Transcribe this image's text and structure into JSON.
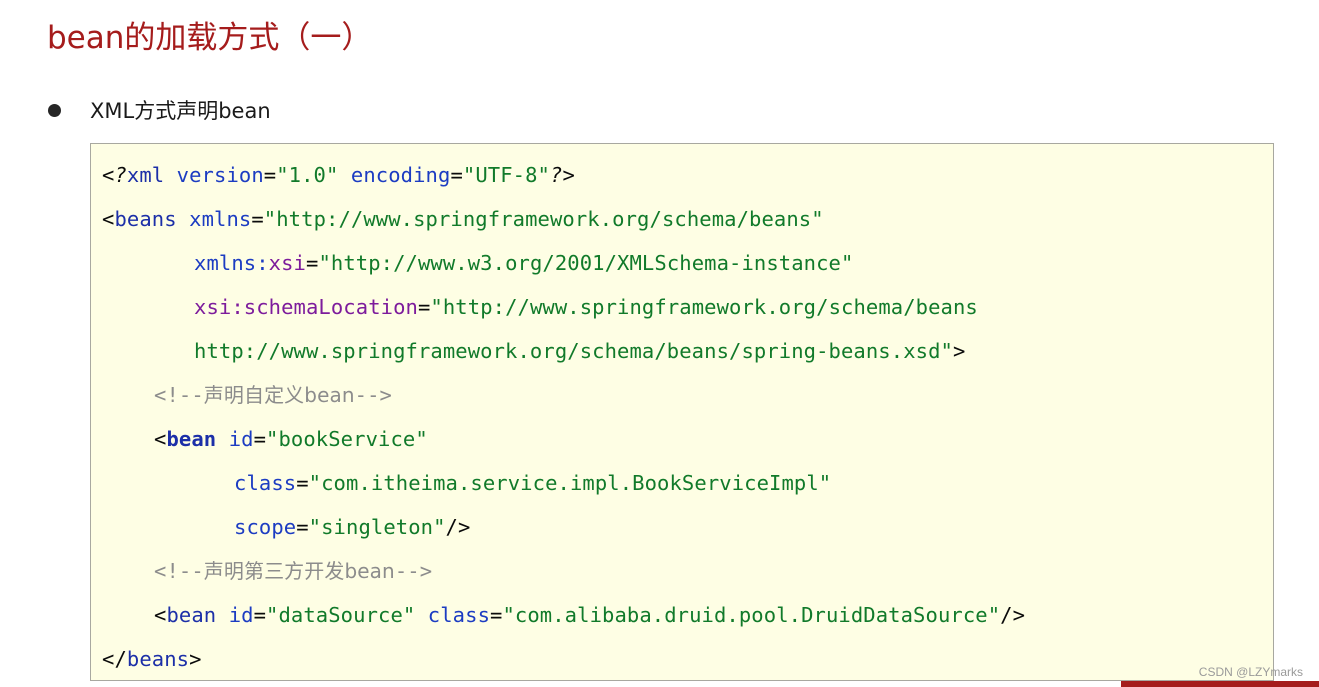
{
  "slide": {
    "title": "bean的加载方式（一）",
    "bullet_text": "XML方式声明bean",
    "watermark": "CSDN @LZYmarks"
  },
  "code": {
    "l1": {
      "pi_open": "<?",
      "tag": "xml",
      "attr1": "version",
      "eq1": "=",
      "val1": "\"1.0\"",
      "attr2": "encoding",
      "eq2": "=",
      "val2": "\"UTF-8\"",
      "pi_close": "?>"
    },
    "l2": {
      "lt": "<",
      "tag": "beans",
      "attr": "xmlns",
      "eq": "=",
      "val": "\"http://www.springframework.org/schema/beans\""
    },
    "l3": {
      "prefix": "xmlns:",
      "local": "xsi",
      "eq": "=",
      "val": "\"http://www.w3.org/2001/XMLSchema-instance\""
    },
    "l4": {
      "attr": "xsi:schemaLocation",
      "eq": "=",
      "val": "\"http://www.springframework.org/schema/beans"
    },
    "l5": {
      "val": "http://www.springframework.org/schema/beans/spring-beans.xsd\"",
      "gt": ">"
    },
    "l6": {
      "open": "<!--",
      "text": "声明自定义bean",
      "close": "-->"
    },
    "l7": {
      "lt": "<",
      "tag": "bean",
      "attr": "id",
      "eq": "=",
      "val": "\"bookService\""
    },
    "l8": {
      "attr": "class",
      "eq": "=",
      "val": "\"com.itheima.service.impl.BookServiceImpl\""
    },
    "l9": {
      "attr": "scope",
      "eq": "=",
      "val": "\"singleton\"",
      "close": "/>"
    },
    "l10": {
      "open": "<!--",
      "text": "声明第三方开发bean",
      "close": "-->"
    },
    "l11": {
      "lt": "<",
      "tag": "bean",
      "attr1": "id",
      "eq1": "=",
      "val1": "\"dataSource\"",
      "attr2": "class",
      "eq2": "=",
      "val2": "\"com.alibaba.druid.pool.DruidDataSource\"",
      "close": "/>"
    },
    "l12": {
      "open": "</",
      "tag": "beans",
      "gt": ">"
    }
  },
  "colors": {
    "title": "#a51c1c",
    "code_background": "#fefee4",
    "tag": "#1c2fa8",
    "attribute": "#1c3cc2",
    "namespace_prefix": "#7d1c9c",
    "string": "#117a2a",
    "comment": "#8c8c8c"
  }
}
